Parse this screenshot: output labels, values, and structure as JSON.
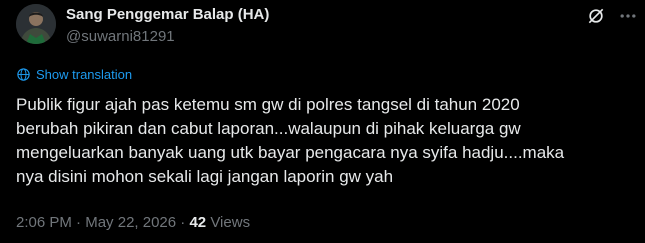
{
  "author": {
    "display_name": "Sang Penggemar Balap (HA)",
    "handle": "@suwarni81291",
    "avatar_icon": "avatar-photo"
  },
  "header_actions": {
    "grok_icon": "grok-icon",
    "more_icon": "more-dots-icon"
  },
  "translation": {
    "label": "Show translation",
    "icon": "globe-icon"
  },
  "tweet": {
    "text": "Publik figur ajah pas ketemu sm gw di polres tangsel di tahun 2020\nberubah pikiran dan cabut laporan...walaupun di pihak keluarga gw\nmengeluarkan banyak uang utk bayar pengacara nya syifa hadju....maka\nnya disini mohon sekali lagi jangan laporin gw yah"
  },
  "meta": {
    "time": "2:06 PM",
    "separator1": " · ",
    "date": "May 22, 2026",
    "separator2": " · ",
    "views_count": "42",
    "views_label": " Views"
  },
  "colors": {
    "background": "#000000",
    "text": "#e7e9ea",
    "secondary": "#71767b",
    "accent": "#1d9bf0"
  }
}
